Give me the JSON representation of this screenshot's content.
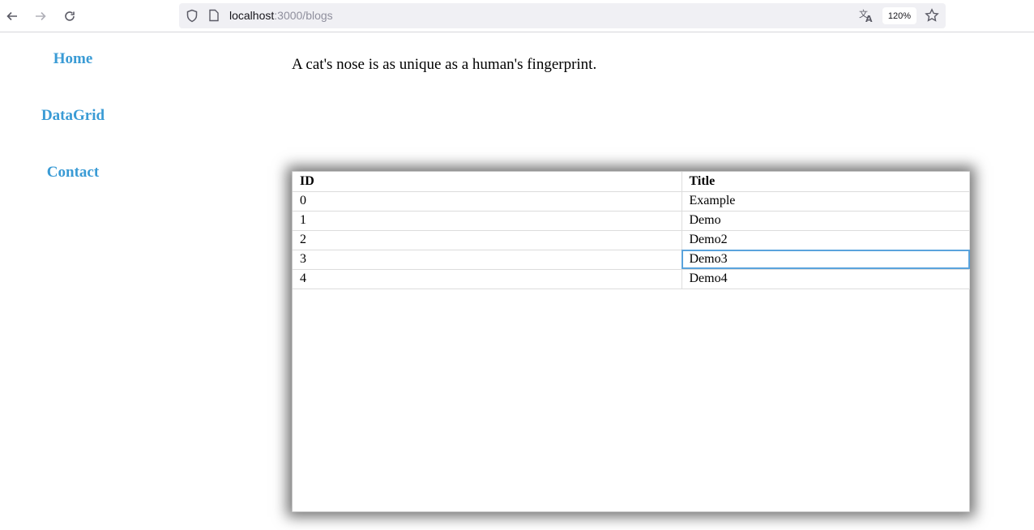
{
  "browser": {
    "url_host": "localhost",
    "url_path": ":3000/blogs",
    "zoom": "120%"
  },
  "sidebar": {
    "items": [
      {
        "label": "Home"
      },
      {
        "label": "DataGrid"
      },
      {
        "label": "Contact"
      }
    ]
  },
  "main": {
    "fact": "A cat's nose is as unique as a human's fingerprint."
  },
  "grid": {
    "headers": [
      "ID",
      "Title"
    ],
    "rows": [
      {
        "id": "0",
        "title": "Example"
      },
      {
        "id": "1",
        "title": "Demo"
      },
      {
        "id": "2",
        "title": "Demo2"
      },
      {
        "id": "3",
        "title": "Demo3"
      },
      {
        "id": "4",
        "title": "Demo4"
      }
    ],
    "focused_cell": "Demo3"
  },
  "colors": {
    "link": "#3a9bd5",
    "focus_outline": "#5aa3dc"
  }
}
